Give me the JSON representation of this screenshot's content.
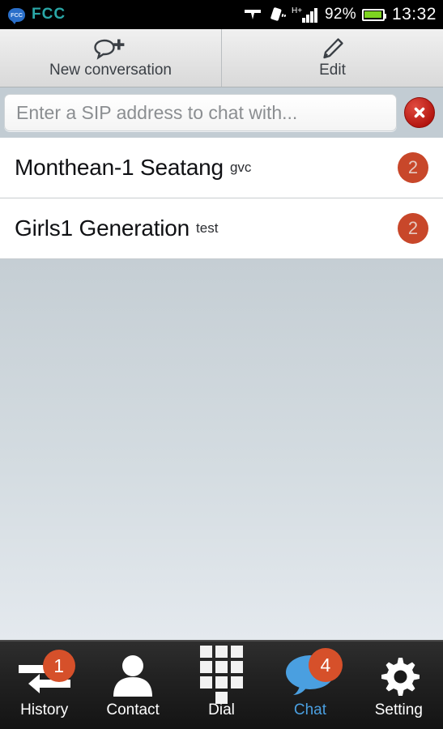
{
  "statusbar": {
    "app_badge_label": "FCC",
    "app_name": "FCC",
    "network_type": "H+",
    "battery_percent": "92%",
    "time": "13:32",
    "icons": [
      "headset-icon",
      "vibrate-icon",
      "signal-bars-icon",
      "battery-icon"
    ]
  },
  "toolbar": {
    "new_conversation_label": "New conversation",
    "edit_label": "Edit"
  },
  "search": {
    "placeholder": "Enter a SIP address to chat with...",
    "value": "",
    "clear_label": "✕"
  },
  "conversations": [
    {
      "name": "Monthean-1 Seatang",
      "subtitle": "gvc",
      "badge": "2"
    },
    {
      "name": "Girls1 Generation",
      "subtitle": "test",
      "badge": "2"
    }
  ],
  "bottom_nav": {
    "items": [
      {
        "label": "History",
        "icon": "history-arrows-icon",
        "badge": "1",
        "active": false
      },
      {
        "label": "Contact",
        "icon": "person-icon",
        "badge": "",
        "active": false
      },
      {
        "label": "Dial",
        "icon": "keypad-icon",
        "badge": "",
        "active": false
      },
      {
        "label": "Chat",
        "icon": "chat-bubble-icon",
        "badge": "4",
        "active": true
      },
      {
        "label": "Setting",
        "icon": "gear-icon",
        "badge": "",
        "active": false
      }
    ]
  },
  "colors": {
    "badge_orange": "#c8472a",
    "nav_badge_orange": "#d6502a",
    "active_blue": "#4a9fe0",
    "chat_bubble_blue": "#4a9fe0",
    "clear_red": "#b2140e",
    "brand_teal": "#2aa7a7"
  }
}
